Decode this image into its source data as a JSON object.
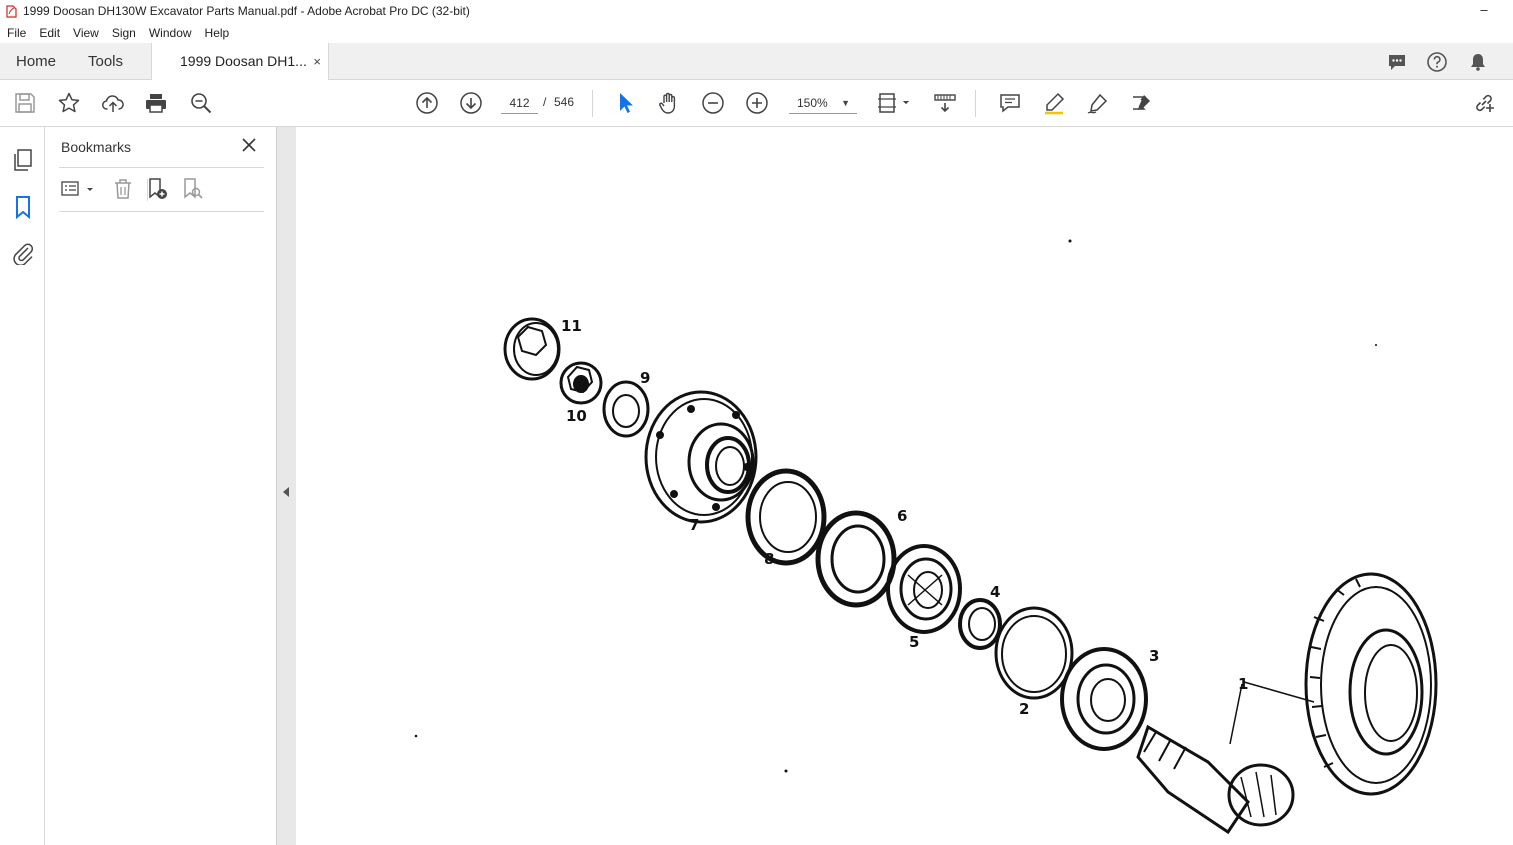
{
  "window": {
    "title": "1999 Doosan DH130W Excavator Parts Manual.pdf - Adobe Acrobat Pro DC (32-bit)",
    "minimize": "–"
  },
  "menu": [
    "File",
    "Edit",
    "View",
    "Sign",
    "Window",
    "Help"
  ],
  "tabs": {
    "home": "Home",
    "tools": "Tools",
    "document": "1999 Doosan DH1...",
    "close": "×"
  },
  "toolbar": {
    "page_current": "412",
    "page_separator": "/",
    "page_total": "546",
    "zoom": "150%"
  },
  "bookmarks": {
    "title": "Bookmarks"
  },
  "diagram": {
    "callouts": [
      "11",
      "10",
      "9",
      "7",
      "8",
      "6",
      "5",
      "4",
      "2",
      "3",
      "1"
    ]
  },
  "icons": {
    "accent": "#1473e6",
    "pdf_red": "#d7261e"
  }
}
